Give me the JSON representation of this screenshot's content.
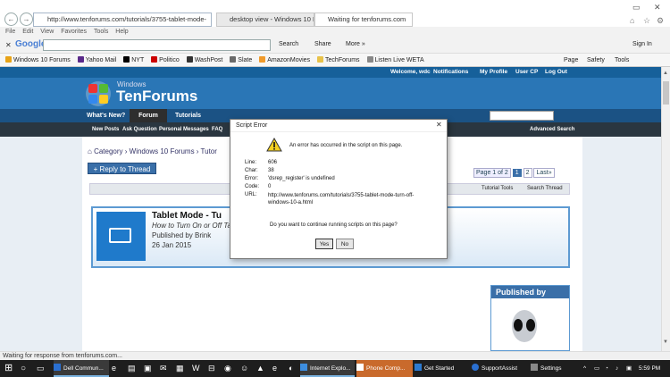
{
  "browser": {
    "back": "←",
    "forward": "→",
    "address": "http://www.tenforums.com/tutorials/3755-tablet-mode-",
    "tabs": [
      {
        "title": "desktop view - Windows 10 Fo..."
      },
      {
        "title": "Waiting for tenforums.com"
      }
    ],
    "menu": [
      "File",
      "Edit",
      "View",
      "Favorites",
      "Tools",
      "Help"
    ],
    "google": {
      "logo": "Google",
      "search_label": "Search",
      "share_label": "Share",
      "more_label": "More »",
      "signin_label": "Sign In"
    },
    "favorites": [
      "Windows 10 Forums",
      "Yahoo Mail",
      "NYT",
      "Politico",
      "WashPost",
      "Slate",
      "AmazonMovies",
      "TechForums",
      "Listen Live  WETA"
    ],
    "toolbar_right": [
      "Page",
      "Safety",
      "Tools"
    ]
  },
  "site": {
    "welcome": "Welcome,  wdc",
    "top_links": [
      "Notifications",
      "My Profile",
      "User CP",
      "Log Out"
    ],
    "logo_small": "Windows",
    "logo_big": "TenForums",
    "nav": [
      "What's New?",
      "Forum",
      "Tutorials"
    ],
    "subnav": [
      "New Posts",
      "Ask Question",
      "Personal Messages",
      "FAQ"
    ],
    "advanced_search": "Advanced Search",
    "breadcrumb": [
      "Category",
      "Windows 10 Forums",
      "Tutor"
    ],
    "reply_button": "+ Reply to Thread",
    "pagination": {
      "label": "Page 1 of 2",
      "pages": [
        "1",
        "2"
      ],
      "last": "Last"
    },
    "thread_tools": "Tutorial Tools",
    "search_thread": "Search Thread",
    "tutorial": {
      "title": "Tablet Mode - Tu",
      "subtitle": "How to Turn On or Off Ta",
      "author": "Published by Brink",
      "date": "26 Jan 2015"
    },
    "published_by": "Published by"
  },
  "dialog": {
    "title": "Script Error",
    "message": "An error has occurred in the script on this page.",
    "fields": [
      {
        "label": "Line:",
        "value": "606"
      },
      {
        "label": "Char:",
        "value": "38"
      },
      {
        "label": "Error:",
        "value": "'dsrep_register' is undefined"
      },
      {
        "label": "Code:",
        "value": "0"
      },
      {
        "label": "URL:",
        "value": "http://www.tenforums.com/tutorials/3755-tablet-mode-turn-off-windows-10-a.html"
      }
    ],
    "question": "Do you want to continue running scripts on this page?",
    "yes": "Yes",
    "no": "No"
  },
  "status": "Waiting for response from tenforums.com...",
  "taskbar": {
    "apps": [
      "Dell Commun...",
      "Internet Explo...",
      "Phone Comp...",
      "Get Started",
      "SupportAssist",
      "Settings"
    ],
    "time": "5:59 PM"
  },
  "colors": {
    "header": "#2a76b6",
    "nav": "#1b5284",
    "accent": "#7ab3e0"
  }
}
